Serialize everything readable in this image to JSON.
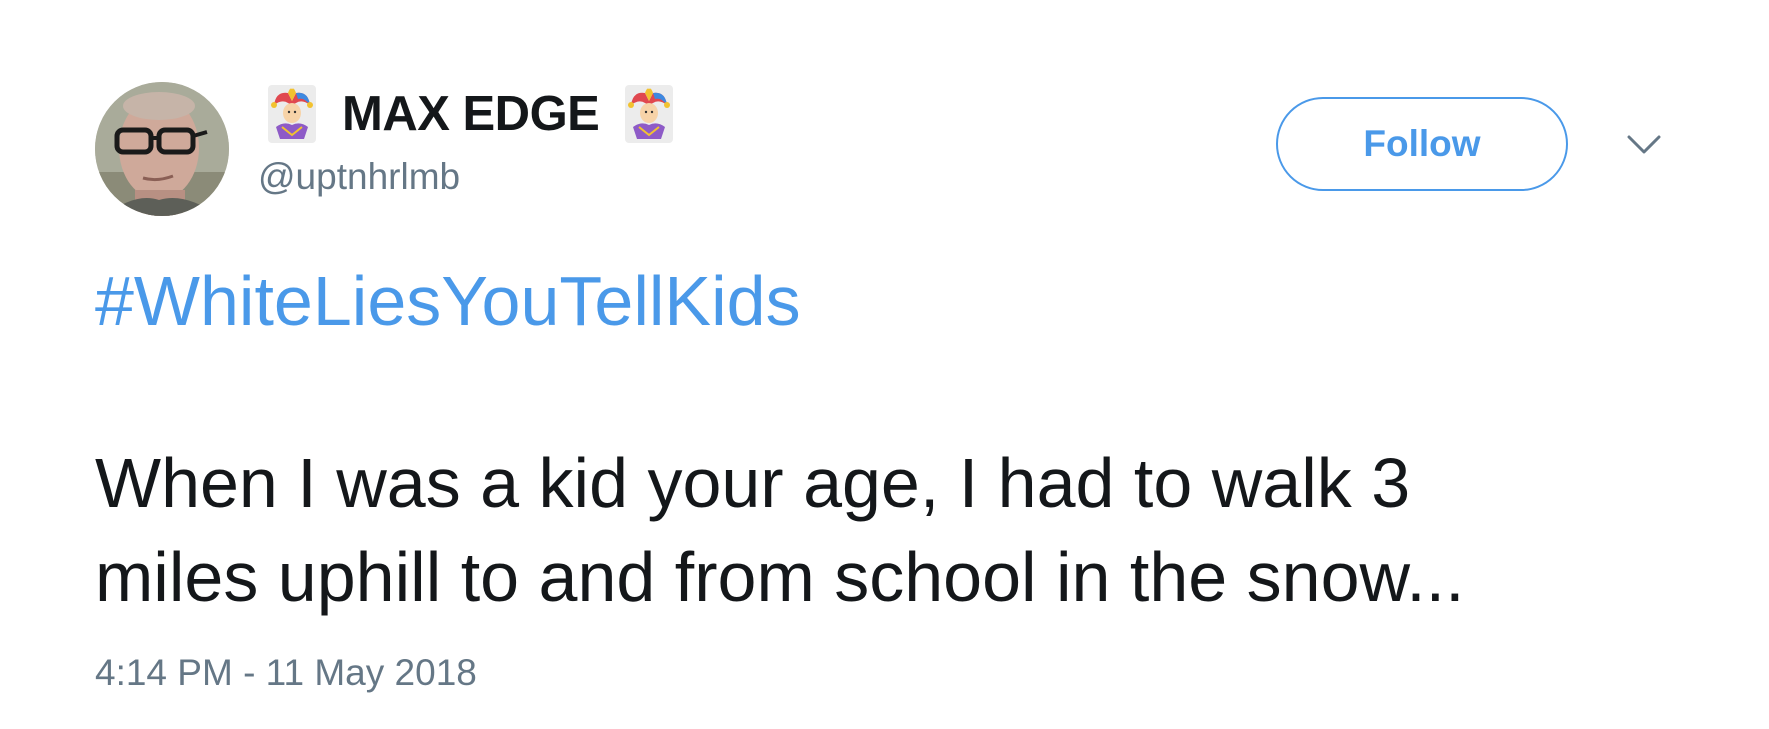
{
  "colors": {
    "accent": "#4a99e9",
    "text_primary": "#14171a",
    "text_secondary": "#657786",
    "background": "#ffffff"
  },
  "author": {
    "display_name": "MAX EDGE",
    "handle": "@uptnhrlmb",
    "name_emoji_left": "jester-emoji-icon",
    "name_emoji_right": "jester-emoji-icon",
    "avatar": "avatar-photo"
  },
  "actions": {
    "follow_label": "Follow",
    "more_icon": "chevron-down-icon"
  },
  "tweet": {
    "hashtag": "#WhiteLiesYouTellKids",
    "text": "When I was a kid your age, I had to walk 3\nmiles uphill to and from school in the snow...",
    "timestamp": "4:14 PM - 11 May 2018"
  }
}
